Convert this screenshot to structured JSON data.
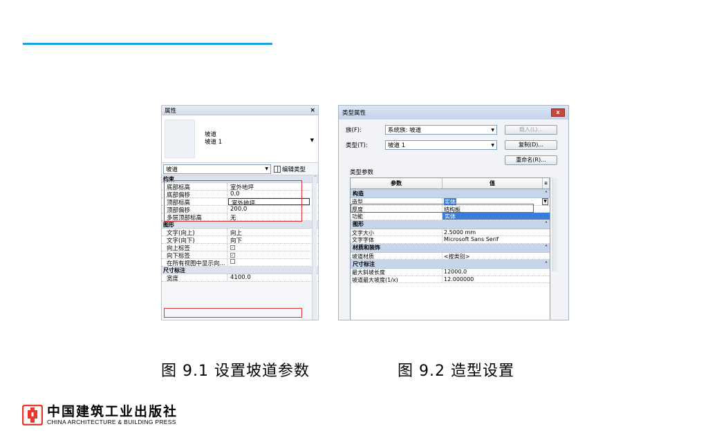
{
  "colors": {
    "accent_line": "#1aa3e8",
    "highlight_box": "#e0303a",
    "logo": "#e8382e",
    "selection": "#3a7bd5"
  },
  "props_panel": {
    "title": "属性",
    "close": "×",
    "element_name": "坡道",
    "element_type": "坡道 1",
    "selector": "坡道",
    "edit_type": "编辑类型",
    "sections": [
      {
        "name": "约束",
        "rows": [
          {
            "key": "底部标高",
            "value": "室外地坪"
          },
          {
            "key": "底部偏移",
            "value": "0.0"
          },
          {
            "key": "顶部标高",
            "value": "室外地坪"
          },
          {
            "key": "顶部偏移",
            "value": "200.0"
          },
          {
            "key": "多层顶部标高",
            "value": "无"
          }
        ]
      },
      {
        "name": "图形",
        "rows": [
          {
            "key": "文字(向上)",
            "value": "向上"
          },
          {
            "key": "文字(向下)",
            "value": "向下"
          },
          {
            "key": "向上标签",
            "value": "✓"
          },
          {
            "key": "向下标签",
            "value": "✓"
          },
          {
            "key": "在所有视图中显示向...",
            "value": ""
          }
        ]
      },
      {
        "name": "尺寸标注",
        "rows": [
          {
            "key": "宽度",
            "value": "4100.0"
          }
        ]
      }
    ]
  },
  "type_dialog": {
    "title": "类型属性",
    "close": "x",
    "family_label": "族(F):",
    "family_value": "系统族: 坡道",
    "type_label": "类型(T):",
    "type_value": "坡道 1",
    "load_button": "载入(L)...",
    "duplicate_button": "复制(D)...",
    "rename_button": "重命名(R)...",
    "params_label": "类型参数",
    "col_param": "参数",
    "col_value": "值",
    "sections": [
      {
        "name": "构造",
        "rows": [
          {
            "key": "造型",
            "value": "实体"
          },
          {
            "key": "厚度",
            "value": "结构板"
          },
          {
            "key": "功能",
            "value": "实体"
          }
        ]
      },
      {
        "name": "图形",
        "rows": [
          {
            "key": "文字大小",
            "value": "2.5000 mm"
          },
          {
            "key": "文字字体",
            "value": "Microsoft Sans Serif"
          }
        ]
      },
      {
        "name": "材质和装饰",
        "rows": [
          {
            "key": "坡道材质",
            "value": "<按类别>"
          }
        ]
      },
      {
        "name": "尺寸标注",
        "rows": [
          {
            "key": "最大斜坡长度",
            "value": "12000.0"
          },
          {
            "key": "坡道最大坡度(1/x)",
            "value": "12.000000"
          }
        ]
      }
    ]
  },
  "captions": {
    "fig1": "图 9.1  设置坡道参数",
    "fig2": "图 9.2  造型设置"
  },
  "publisher": {
    "name_cn": "中国建筑工业出版社",
    "name_en": "CHINA ARCHITECTURE & BUILDING PRESS"
  }
}
